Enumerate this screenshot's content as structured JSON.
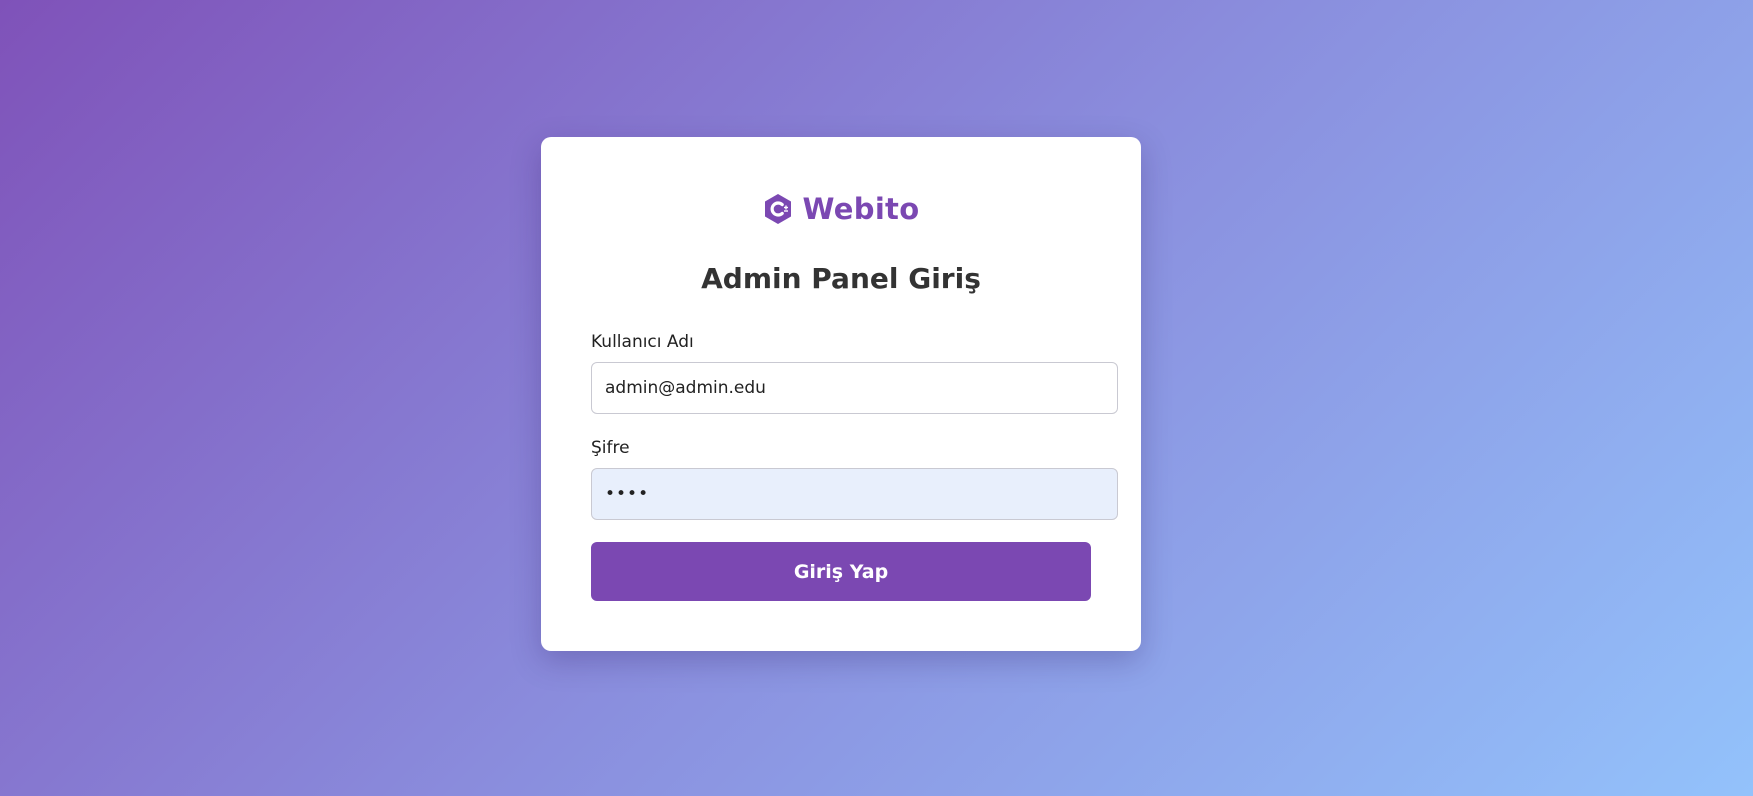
{
  "brand": {
    "name": "Webito",
    "icon": "hexagon-c-logo-icon",
    "color": "#7b48b2"
  },
  "login": {
    "title": "Admin Panel Giriş",
    "username_label": "Kullanıcı Adı",
    "username_value": "admin@admin.edu",
    "password_label": "Şifre",
    "password_value": "1234",
    "submit_label": "Giriş Yap"
  },
  "colors": {
    "accent": "#7b48b2",
    "autofill_bg": "#e8effc",
    "background_gradient_start": "#7f52b9",
    "background_gradient_end": "#93c2fb"
  }
}
